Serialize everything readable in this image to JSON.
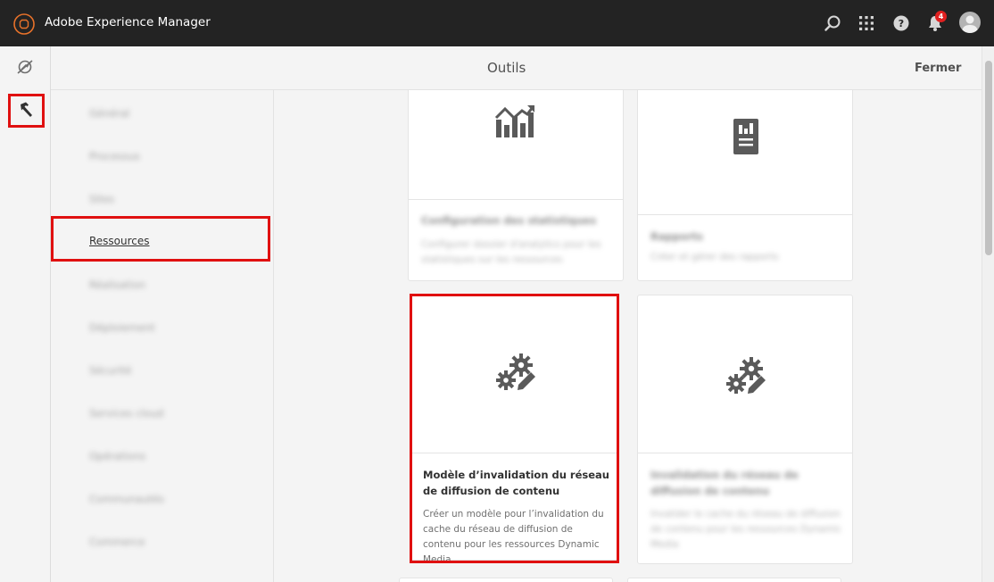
{
  "header": {
    "app_title": "Adobe Experience Manager",
    "notification_count": "4",
    "icons": [
      "search-icon",
      "apps-grid-icon",
      "help-icon",
      "bell-icon",
      "avatar"
    ]
  },
  "panel": {
    "title": "Outils",
    "close_label": "Fermer"
  },
  "rail": {
    "items": [
      "navigation-icon",
      "tools-hammer-icon"
    ]
  },
  "categories": [
    {
      "label": "Général",
      "active": false
    },
    {
      "label": "Processus",
      "active": false
    },
    {
      "label": "Sites",
      "active": false
    },
    {
      "label": "Ressources",
      "active": true
    },
    {
      "label": "Réalisation",
      "active": false
    },
    {
      "label": "Déploiement",
      "active": false
    },
    {
      "label": "Sécurité",
      "active": false
    },
    {
      "label": "Services cloud",
      "active": false
    },
    {
      "label": "Opérations",
      "active": false
    },
    {
      "label": "Communautés",
      "active": false
    },
    {
      "label": "Commerce",
      "active": false
    }
  ],
  "cards": [
    {
      "title": "Configuration des statistiques",
      "desc": "Configurer dossier d'analytics pour les statistiques sur les ressources",
      "icon": "analytics-chart-icon"
    },
    {
      "title": "Rapports",
      "desc": "Créer et gérer des rapports",
      "icon": "report-icon"
    },
    {
      "title": "Modèle d’invalidation du réseau de diffusion de contenu",
      "desc": "Créer un modèle pour l’invalidation du cache du réseau de diffusion de contenu pour les ressources Dynamic Media",
      "icon": "gears-edit-icon"
    },
    {
      "title": "Invalidation du réseau de diffusion de contenu",
      "desc": "Invalider le cache du réseau de diffusion de contenu pour les ressources Dynamic Media",
      "icon": "gears-edit-icon"
    }
  ],
  "colors": {
    "topbar": "#232323",
    "highlight": "#e01010",
    "badge": "#e02020"
  }
}
